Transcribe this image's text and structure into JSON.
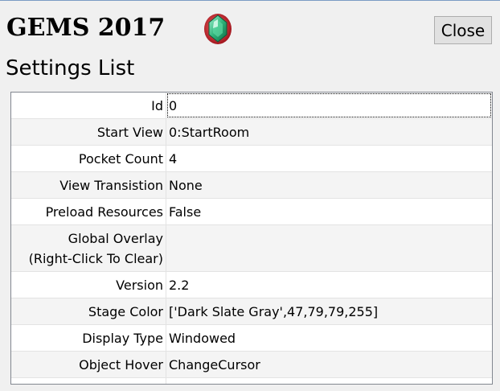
{
  "app": {
    "title": "GEMS 2017",
    "icon": "gem-icon"
  },
  "toolbar": {
    "close_label": "Close"
  },
  "section": {
    "title": "Settings List"
  },
  "settings": [
    {
      "label": "Id",
      "value": "0"
    },
    {
      "label": "Start View",
      "value": "0:StartRoom"
    },
    {
      "label": "Pocket Count",
      "value": "4"
    },
    {
      "label": "View Transistion",
      "value": "None"
    },
    {
      "label": "Preload Resources",
      "value": "False"
    },
    {
      "label": "Global Overlay\n(Right-Click To Clear)",
      "value": ""
    },
    {
      "label": "Version",
      "value": "2.2"
    },
    {
      "label": "Stage Color",
      "value": "['Dark Slate Gray',47,79,79,255]"
    },
    {
      "label": "Display Type",
      "value": "Windowed"
    },
    {
      "label": "Object Hover",
      "value": "ChangeCursor"
    }
  ],
  "colors": {
    "accent": "#7a9cc4",
    "gem_green": "#2fb37a",
    "gem_red": "#d0202e"
  }
}
